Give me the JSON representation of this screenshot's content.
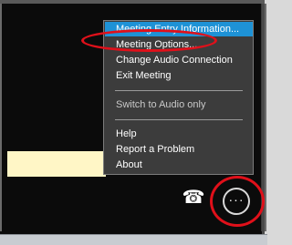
{
  "menu": {
    "items": [
      {
        "label": "Meeting Entry Information...",
        "state": "highlighted"
      },
      {
        "label": "Meeting Options...",
        "state": "normal"
      },
      {
        "label": "Change Audio Connection",
        "state": "normal"
      },
      {
        "label": "Exit Meeting",
        "state": "normal"
      },
      {
        "label": "Switch to Audio only",
        "state": "disabled"
      },
      {
        "label": "Help",
        "state": "normal"
      },
      {
        "label": "Report a Problem",
        "state": "normal"
      },
      {
        "label": "About",
        "state": "normal"
      }
    ]
  },
  "toolbar": {
    "phone_icon": "☎",
    "more_icon": "···"
  },
  "colors": {
    "highlight": "#1e92d6",
    "annotation": "#e0101a",
    "menu_bg": "#3c3c3c"
  },
  "icons": {
    "phone": "phone-icon",
    "more": "more-options-icon"
  }
}
